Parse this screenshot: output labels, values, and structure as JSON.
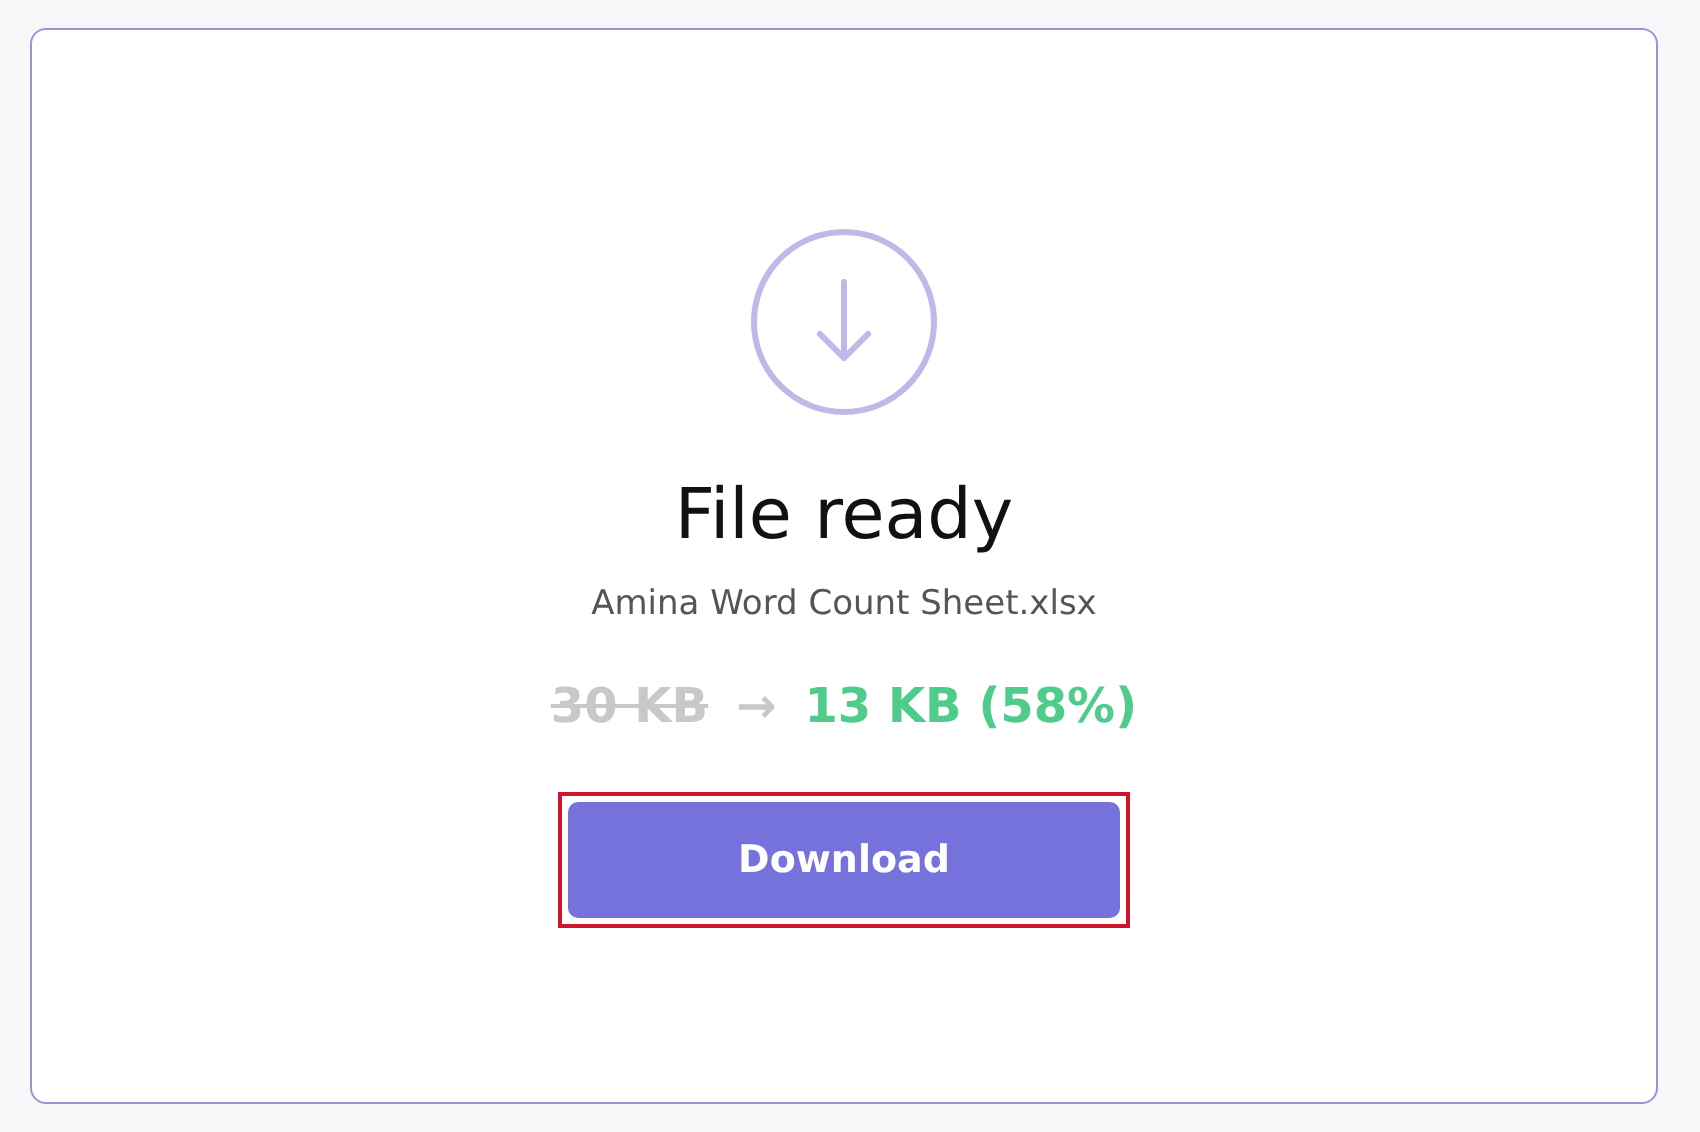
{
  "title": "File ready",
  "filename": "Amina Word Count Sheet.xlsx",
  "sizes": {
    "original": "30 KB",
    "arrow": "→",
    "compressed": "13 KB (58%)"
  },
  "download_button": {
    "label": "Download",
    "highlighted": true
  }
}
